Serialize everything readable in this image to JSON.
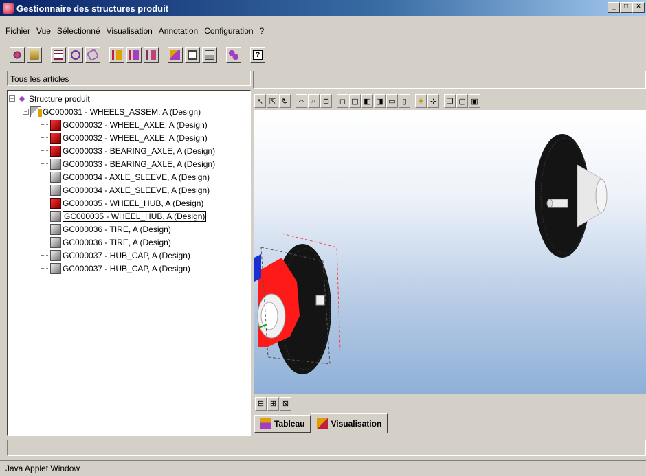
{
  "window": {
    "title": "Gestionnaire des structures produit"
  },
  "menu": [
    "Fichier",
    "Vue",
    "Sélectionné",
    "Visualisation",
    "Annotation",
    "Configuration",
    "?"
  ],
  "toolbar_icons": [
    "settings-gear-icon",
    "open-folder-icon",
    "table-icon",
    "refresh-icon",
    "link-icon",
    "tree-expand-icon",
    "tree-expand2-icon",
    "tree-collapse-icon",
    "edit-icon",
    "view-icon",
    "props-icon",
    "structure-icon",
    "help-icon"
  ],
  "left_panel": {
    "label": "Tous les articles"
  },
  "tree": {
    "root": "Structure produit",
    "assembly": "GC000031 - WHEELS_ASSEM, A (Design)",
    "items": [
      {
        "label": "GC000032 - WHEEL_AXLE, A (Design)",
        "icon": "part-red-icon"
      },
      {
        "label": "GC000032 - WHEEL_AXLE, A (Design)",
        "icon": "part-red-icon"
      },
      {
        "label": "GC000033 - BEARING_AXLE, A (Design)",
        "icon": "part-red-icon"
      },
      {
        "label": "GC000033 - BEARING_AXLE, A (Design)",
        "icon": "part-icon"
      },
      {
        "label": "GC000034 - AXLE_SLEEVE, A (Design)",
        "icon": "part-icon"
      },
      {
        "label": "GC000034 - AXLE_SLEEVE, A (Design)",
        "icon": "part-icon"
      },
      {
        "label": "GC000035 - WHEEL_HUB, A (Design)",
        "icon": "part-red-icon"
      },
      {
        "label": "GC000035 - WHEEL_HUB, A (Design)",
        "icon": "part-icon",
        "selected": true
      },
      {
        "label": "GC000036 - TIRE, A (Design)",
        "icon": "part-icon"
      },
      {
        "label": "GC000036 - TIRE, A (Design)",
        "icon": "part-icon"
      },
      {
        "label": "GC000037 - HUB_CAP, A (Design)",
        "icon": "part-icon"
      },
      {
        "label": "GC000037 - HUB_CAP, A (Design)",
        "icon": "part-icon"
      }
    ]
  },
  "tabs": [
    {
      "label": "Tableau",
      "active": false
    },
    {
      "label": "Visualisation",
      "active": true
    }
  ],
  "status": {
    "applet": "Java Applet Window"
  },
  "colors": {
    "title_start": "#0a246a",
    "title_end": "#a6caf0",
    "face": "#d4d0c8",
    "highlight_red": "#ff1a1a"
  }
}
